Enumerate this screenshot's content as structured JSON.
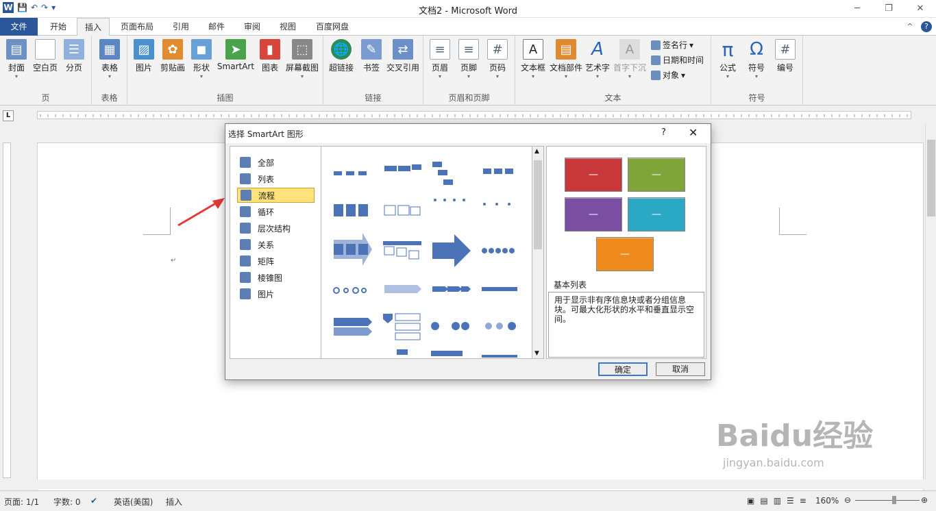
{
  "window": {
    "title": "文档2 - Microsoft Word",
    "controls": [
      "─",
      "❐",
      "✕"
    ]
  },
  "tabs": [
    "文件",
    "开始",
    "插入",
    "页面布局",
    "引用",
    "邮件",
    "审阅",
    "视图",
    "百度网盘"
  ],
  "groups": {
    "page": {
      "label": "页",
      "buttons": [
        "封面",
        "空白页",
        "分页"
      ]
    },
    "table": {
      "label": "表格",
      "buttons": [
        "表格"
      ]
    },
    "illustrations": {
      "label": "插图",
      "buttons": [
        "图片",
        "剪贴画",
        "形状",
        "SmartArt",
        "图表",
        "屏幕截图"
      ]
    },
    "links": {
      "label": "链接",
      "buttons": [
        "超链接",
        "书签",
        "交叉引用"
      ]
    },
    "header_footer": {
      "label": "页眉和页脚",
      "buttons": [
        "页眉",
        "页脚",
        "页码"
      ]
    },
    "text": {
      "label": "文本",
      "buttons": [
        "文本框",
        "文档部件",
        "艺术字",
        "首字下沉"
      ],
      "small": [
        "签名行",
        "日期和时间",
        "对象"
      ]
    },
    "symbols": {
      "label": "符号",
      "buttons": [
        "公式",
        "符号",
        "编号"
      ]
    }
  },
  "dialog": {
    "title": "选择 SmartArt 图形",
    "help": "?",
    "close": "✕",
    "categories": [
      "全部",
      "列表",
      "流程",
      "循环",
      "层次结构",
      "关系",
      "矩阵",
      "棱锥图",
      "图片"
    ],
    "preview_name": "基本列表",
    "preview_desc": "用于显示非有序信息块或者分组信息块。可最大化形状的水平和垂直显示空间。",
    "ok": "确定",
    "cancel": "取消",
    "preview_colors": [
      "#c8373a",
      "#7fa53a",
      "#7a4fa2",
      "#2aa8c4",
      "#ef8a1c"
    ]
  },
  "status": {
    "page": "页面: 1/1",
    "words": "字数: 0",
    "lang": "英语(美国)",
    "mode": "插入",
    "zoom": "160%"
  },
  "watermark": {
    "brand": "Baidu经验",
    "url": "jingyan.baidu.com"
  }
}
